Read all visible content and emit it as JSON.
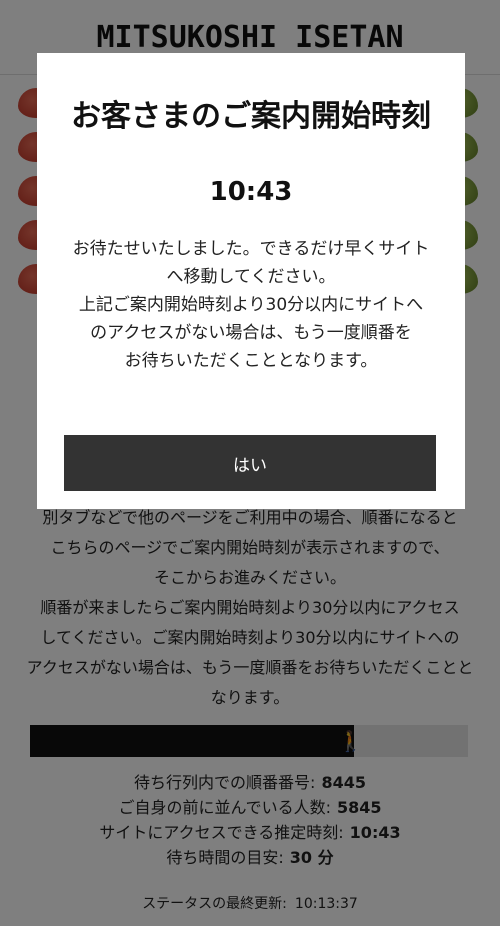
{
  "header": {
    "logo": "MITSUKOSHI ISETAN"
  },
  "modal": {
    "title": "お客さまのご案内開始時刻",
    "time": "10:43",
    "message_lines": [
      "お待たせいたしました。できるだけ早くサイト",
      "へ移動してください。",
      "上記ご案内開始時刻より30分以内にサイトへ",
      "のアクセスがない場合は、もう一度順番を",
      "お待ちいただくこととなります。"
    ],
    "confirm_label": "はい"
  },
  "body_lines": [
    "別タブなどで他のページをご利用中の場合、順番になると",
    "こちらのページでご案内開始時刻が表示されますので、",
    "そこからお進みください。",
    "順番が来ましたらご案内開始時刻より30分以内にアクセス",
    "してください。ご案内開始時刻より30分以内にサイトへの",
    "アクセスがない場合は、もう一度順番をお待ちいただくことと",
    "なります。"
  ],
  "progress": {
    "fraction": 0.74
  },
  "stats": [
    {
      "label": "待ち行列内での順番番号:",
      "value": "8445"
    },
    {
      "label": "ご自身の前に並んでいる人数:",
      "value": "5845"
    },
    {
      "label": "サイトにアクセスできる推定時刻:",
      "value": "10:43"
    },
    {
      "label": "待ち時間の目安:",
      "value": "30 分"
    }
  ],
  "updated": {
    "label": "ステータスの最終更新:",
    "value": "10:13:37"
  },
  "colors": {
    "overlay": "rgba(0,0,0,0.5)",
    "button": "#333333",
    "progress_fill": "#111111"
  }
}
